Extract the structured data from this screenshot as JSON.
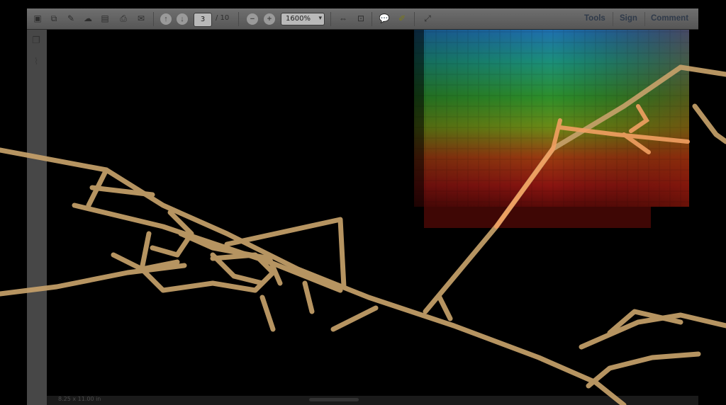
{
  "toolbar": {
    "page_current": "3",
    "page_total": "/ 10",
    "zoom": "1600%",
    "right_links": [
      "Tools",
      "Sign",
      "Comment"
    ]
  },
  "icons": {
    "create": "create-pdf-icon",
    "combine": "combine-icon",
    "edit": "edit-icon",
    "cloud": "cloud-upload-icon",
    "save": "save-icon",
    "print": "print-icon",
    "email": "email-icon",
    "prev_page": "arrow-up-icon",
    "next_page": "arrow-down-icon",
    "zoom_out": "zoom-out-icon",
    "zoom_in": "zoom-in-icon",
    "fit_width": "fit-width-icon",
    "fit_page": "fit-page-icon",
    "comment": "comment-icon",
    "highlight": "highlight-icon",
    "fullscreen": "fullscreen-icon",
    "pages_panel": "pages-panel-icon",
    "attachments_panel": "attachments-panel-icon"
  },
  "status": {
    "page_size": "8.25 x 11.00 in"
  },
  "colors": {
    "stroke": "#c6a16a",
    "toolbar_bg": "#5f5f5f",
    "link": "#2f3a4a"
  }
}
